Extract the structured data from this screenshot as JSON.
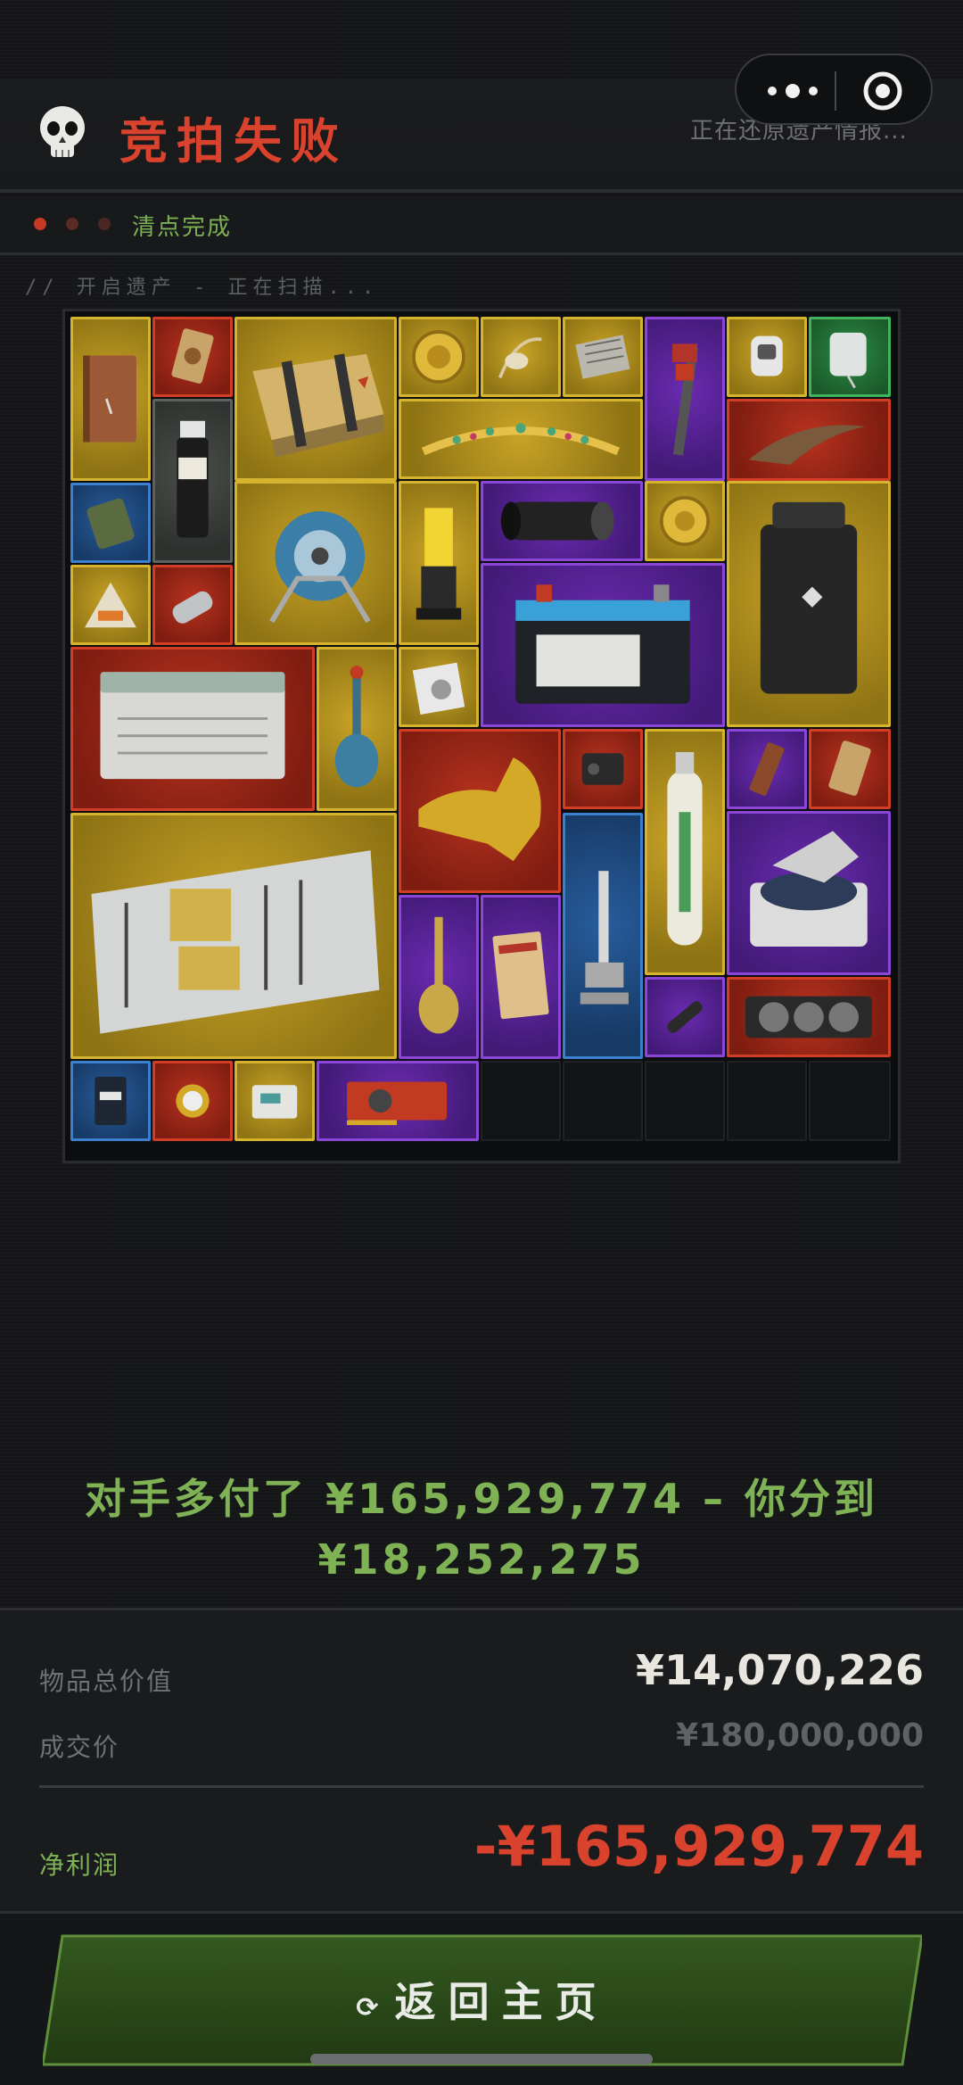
{
  "header": {
    "title": "竞拍失败",
    "status_text": "正在还原遗产情报...",
    "skull_icon": "skull-icon"
  },
  "capsule": {
    "more_icon": "more-dots-icon",
    "target_icon": "target-icon"
  },
  "subbar": {
    "label": "清点完成",
    "leds": [
      "#c63a25",
      "#5a2a24",
      "#4a2724"
    ]
  },
  "scan_text": "// 开启遗产 - 正在扫描...",
  "items": [
    {
      "name": "leather-journal",
      "rarity": "gold"
    },
    {
      "name": "tarot-card",
      "rarity": "red"
    },
    {
      "name": "weapon-crate",
      "rarity": "gold"
    },
    {
      "name": "gold-coin",
      "rarity": "gold"
    },
    {
      "name": "bird-skull-necklace",
      "rarity": "gold"
    },
    {
      "name": "circuit-module",
      "rarity": "gold"
    },
    {
      "name": "pipe-wrench",
      "rarity": "purple"
    },
    {
      "name": "smart-watch",
      "rarity": "gold"
    },
    {
      "name": "iv-bag",
      "rarity": "green"
    },
    {
      "name": "medical-sample-vial",
      "rarity": "grey"
    },
    {
      "name": "jeweled-tiara",
      "rarity": "gold"
    },
    {
      "name": "dinosaur-claw",
      "rarity": "red"
    },
    {
      "name": "ration-pack",
      "rarity": "blue"
    },
    {
      "name": "cable-reel",
      "rarity": "gold"
    },
    {
      "name": "uv-lamp",
      "rarity": "gold"
    },
    {
      "name": "camera-lens",
      "rarity": "purple"
    },
    {
      "name": "gold-medallion",
      "rarity": "gold"
    },
    {
      "name": "power-station",
      "rarity": "gold"
    },
    {
      "name": "sea-snack-bag",
      "rarity": "gold"
    },
    {
      "name": "metal-keychain",
      "rarity": "red"
    },
    {
      "name": "car-battery",
      "rarity": "purple"
    },
    {
      "name": "server-power-supply",
      "rarity": "red"
    },
    {
      "name": "glass-decanter",
      "rarity": "gold"
    },
    {
      "name": "floppy-disk",
      "rarity": "gold"
    },
    {
      "name": "golden-crocodile-head",
      "rarity": "red"
    },
    {
      "name": "tactical-radio",
      "rarity": "red"
    },
    {
      "name": "oxygen-tank",
      "rarity": "gold"
    },
    {
      "name": "chocolate-bar",
      "rarity": "purple"
    },
    {
      "name": "card-pack",
      "rarity": "red"
    },
    {
      "name": "server-blade",
      "rarity": "gold"
    },
    {
      "name": "microscope",
      "rarity": "blue"
    },
    {
      "name": "centrifuge",
      "rarity": "purple"
    },
    {
      "name": "brass-hookah",
      "rarity": "purple"
    },
    {
      "name": "black-tide-book",
      "rarity": "purple"
    },
    {
      "name": "flashlight",
      "rarity": "purple"
    },
    {
      "name": "graphics-card",
      "rarity": "red"
    },
    {
      "name": "coffee-bag",
      "rarity": "blue"
    },
    {
      "name": "gold-wristwatch",
      "rarity": "red"
    },
    {
      "name": "power-meter",
      "rarity": "gold"
    },
    {
      "name": "red-gpu-card",
      "rarity": "purple"
    }
  ],
  "message": {
    "line1": "对手多付了 ¥165,929,774 – 你分到",
    "line2": "¥18,252,275"
  },
  "summary": {
    "total_label": "物品总价值",
    "total_value": "¥14,070,226",
    "deal_label": "成交价",
    "deal_value": "¥180,000,000",
    "profit_label": "净利润",
    "profit_value": "-¥165,929,774"
  },
  "home_button": {
    "label": "返回主页",
    "icon": "refresh-icon"
  },
  "colors": {
    "accent_red": "#d9432e",
    "accent_green": "#7fb255",
    "button_green": "#2b4a1c"
  }
}
